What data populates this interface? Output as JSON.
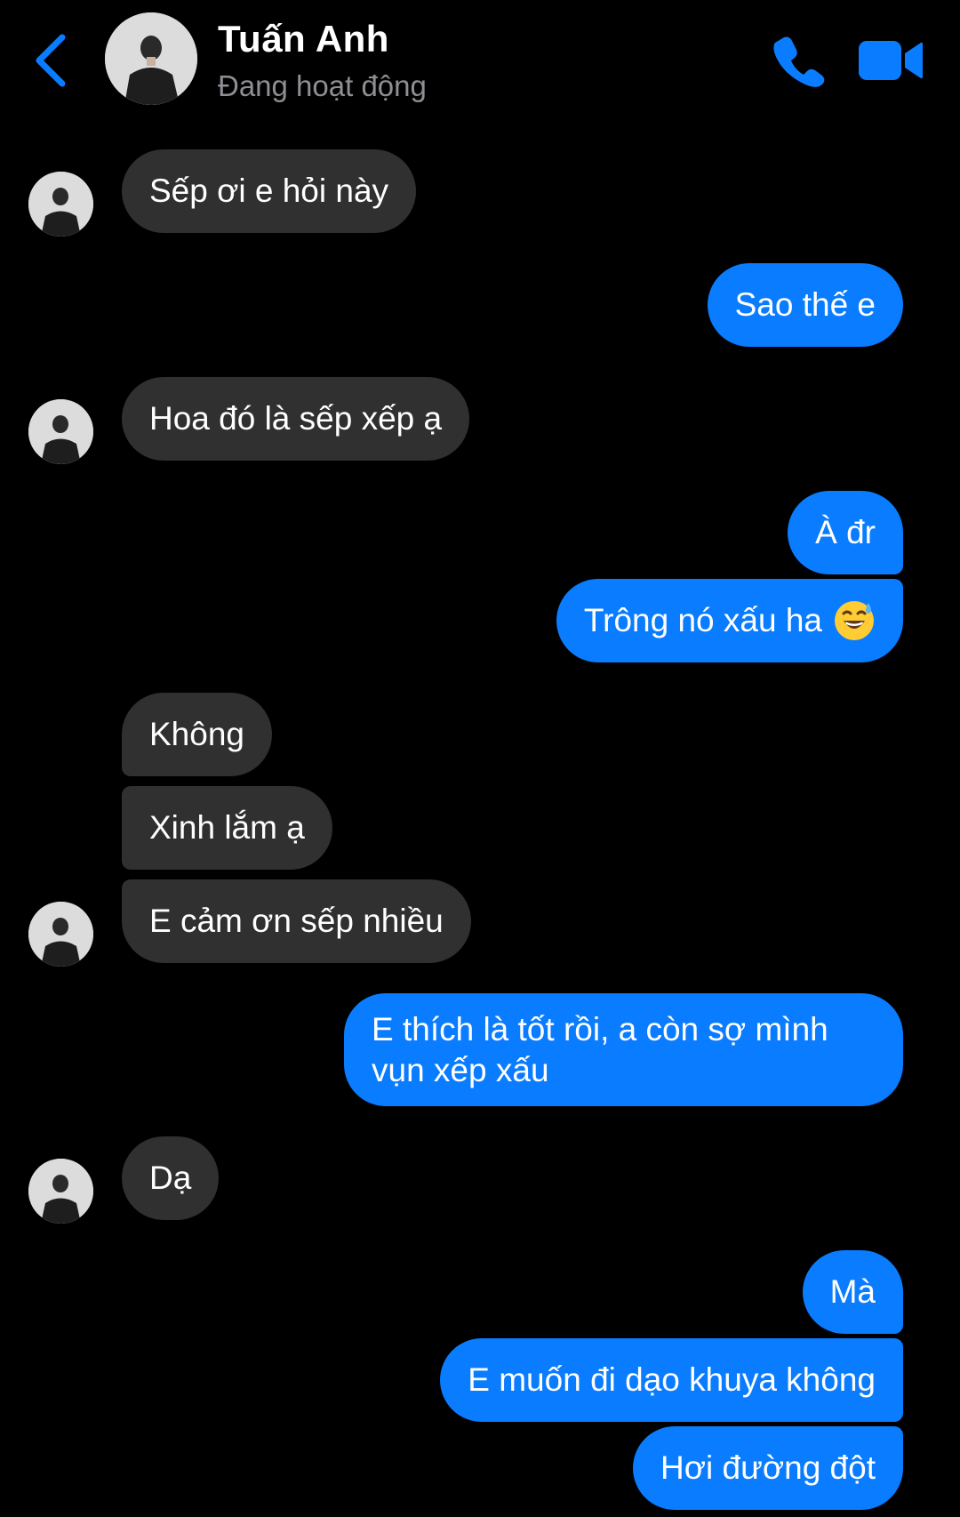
{
  "header": {
    "contact_name": "Tuấn Anh",
    "status": "Đang hoạt động",
    "icons": {
      "back": "chevron-left-icon",
      "call": "phone-icon",
      "video": "video-camera-icon"
    }
  },
  "colors": {
    "accent": "#0a7cff",
    "incoming_bubble": "#303030",
    "background": "#000000",
    "secondary_text": "#8e8e93"
  },
  "messages": [
    {
      "from": "contact",
      "text": "Sếp ơi e hỏi này"
    },
    {
      "from": "me",
      "text": "Sao thế e"
    },
    {
      "from": "contact",
      "text": "Hoa đó là sếp xếp ạ"
    },
    {
      "from": "me",
      "text": "À đr"
    },
    {
      "from": "me",
      "text": "Trông nó xấu ha",
      "emoji": "grinning-sweat-emoji"
    },
    {
      "from": "contact",
      "text": "Không"
    },
    {
      "from": "contact",
      "text": "Xinh lắm ạ"
    },
    {
      "from": "contact",
      "text": "E cảm ơn sếp nhiều"
    },
    {
      "from": "me",
      "text": "E thích là tốt rồi, a còn sợ mình vụn xếp xấu"
    },
    {
      "from": "contact",
      "text": "Dạ"
    },
    {
      "from": "me",
      "text": "Mà"
    },
    {
      "from": "me",
      "text": "E muốn đi dạo khuya không"
    },
    {
      "from": "me",
      "text": "Hơi đường đột"
    }
  ]
}
